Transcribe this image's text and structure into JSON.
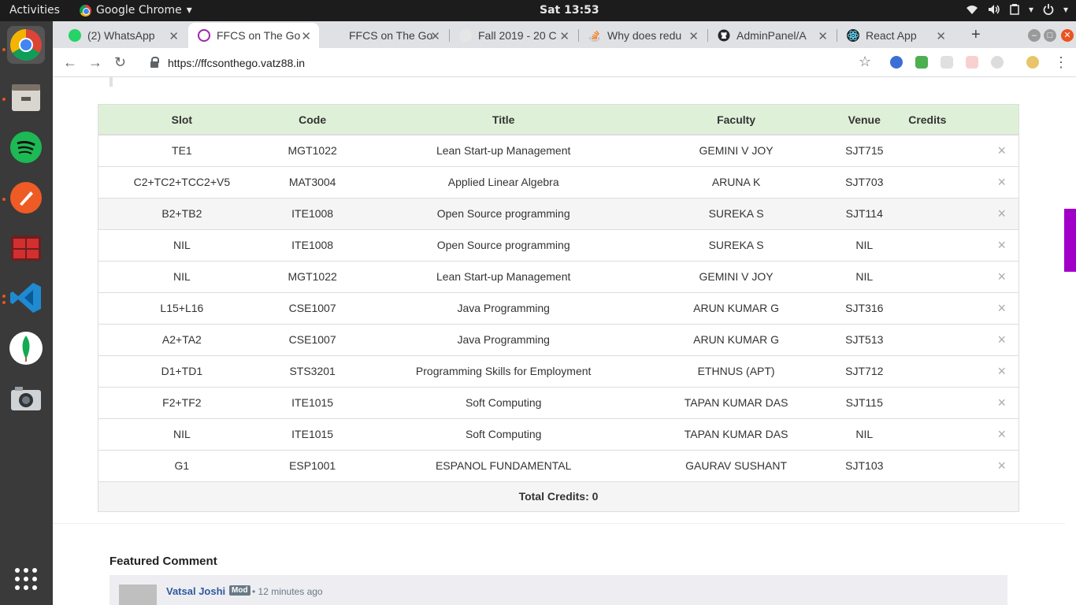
{
  "topbar": {
    "activities": "Activities",
    "app_name": "Google Chrome",
    "clock": "Sat 13:53"
  },
  "tabs": [
    {
      "title": "(2) WhatsApp",
      "favicon_color": "#25d366"
    },
    {
      "title": "FFCS on The Go",
      "favicon_color": "#9c27b0"
    },
    {
      "title": "FFCS on The Go",
      "favicon_color": "#9c27b0"
    },
    {
      "title": "Fall 2019 - 20 C",
      "favicon_color": "#555555"
    },
    {
      "title": "Why does redu",
      "favicon_color": "#f48024"
    },
    {
      "title": "AdminPanel/A",
      "favicon_color": "#24292e"
    },
    {
      "title": "React App",
      "favicon_color": "#61dafb"
    }
  ],
  "toolbar": {
    "url": "https://ffcsonthego.vatz88.in"
  },
  "table": {
    "headers": [
      "Slot",
      "Code",
      "Title",
      "Faculty",
      "Venue",
      "Credits"
    ],
    "rows": [
      [
        "TE1",
        "MGT1022",
        "Lean Start-up Management",
        "GEMINI V JOY",
        "SJT715"
      ],
      [
        "C2+TC2+TCC2+V5",
        "MAT3004",
        "Applied Linear Algebra",
        "ARUNA K",
        "SJT703"
      ],
      [
        "B2+TB2",
        "ITE1008",
        "Open Source programming",
        "SUREKA S",
        "SJT114"
      ],
      [
        "NIL",
        "ITE1008",
        "Open Source programming",
        "SUREKA S",
        "NIL"
      ],
      [
        "NIL",
        "MGT1022",
        "Lean Start-up Management",
        "GEMINI V JOY",
        "NIL"
      ],
      [
        "L15+L16",
        "CSE1007",
        "Java Programming",
        "ARUN KUMAR G",
        "SJT316"
      ],
      [
        "A2+TA2",
        "CSE1007",
        "Java Programming",
        "ARUN KUMAR G",
        "SJT513"
      ],
      [
        "D1+TD1",
        "STS3201",
        "Programming Skills for Employment",
        "ETHNUS (APT)",
        "SJT712"
      ],
      [
        "F2+TF2",
        "ITE1015",
        "Soft Computing",
        "TAPAN KUMAR DAS",
        "SJT115"
      ],
      [
        "NIL",
        "ITE1015",
        "Soft Computing",
        "TAPAN KUMAR DAS",
        "NIL"
      ],
      [
        "G1",
        "ESP1001",
        "ESPANOL FUNDAMENTAL",
        "GAURAV SUSHANT",
        "SJT103"
      ]
    ],
    "remove_glyph": "×",
    "total_credits": "Total Credits: 0"
  },
  "comments": {
    "heading": "Featured Comment",
    "author": "Vatsal Joshi",
    "badge": "Mod",
    "time": "• 12 minutes ago"
  }
}
